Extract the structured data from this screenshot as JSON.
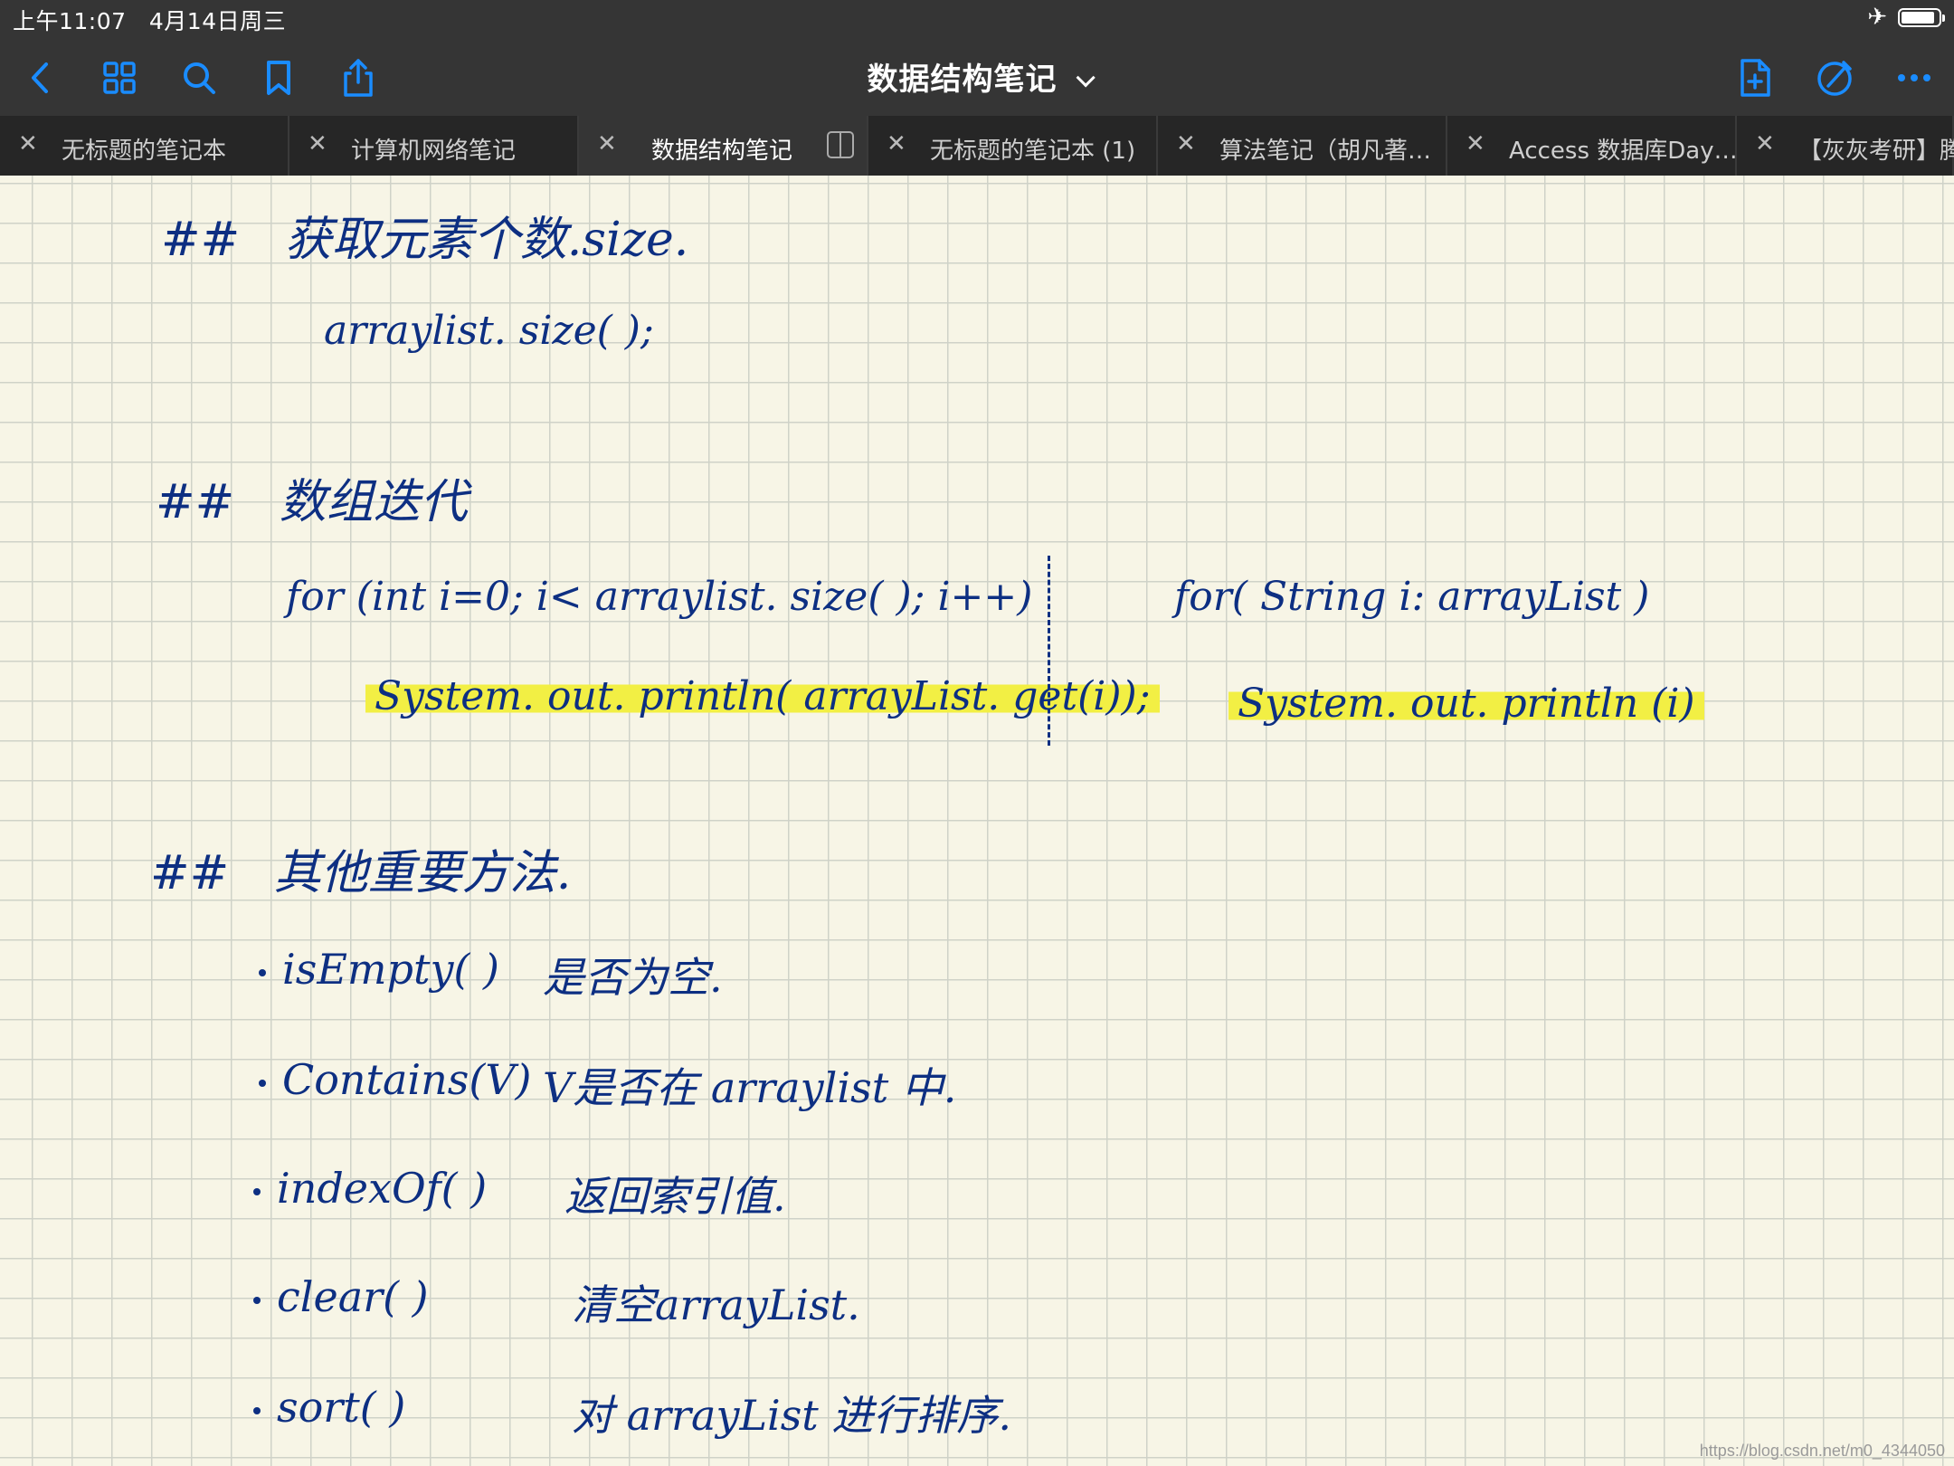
{
  "status": {
    "time": "上午11:07",
    "date": "4月14日周三"
  },
  "toolbar": {
    "title": "数据结构笔记"
  },
  "tabs": [
    {
      "label": "无标题的笔记本"
    },
    {
      "label": "计算机网络笔记"
    },
    {
      "label": "数据结构笔记"
    },
    {
      "label": "无标题的笔记本 (1)"
    },
    {
      "label": "算法笔记（胡凡著…"
    },
    {
      "label": "Access 数据库Day…"
    },
    {
      "label": "【灰灰考研】腾"
    }
  ],
  "note": {
    "section1": {
      "mark": "##",
      "title": "获取元素个数.size.",
      "code": "arraylist. size( );"
    },
    "section2": {
      "mark": "##",
      "title": "数组迭代",
      "left_loop": "for (int i=0;  i< arraylist. size( ); i++)",
      "left_body": "System. out. println( arrayList. get(i));",
      "right_loop": "for( String i:  arrayList )",
      "right_body": "System. out. println (i)"
    },
    "section3": {
      "mark": "##",
      "title": "其他重要方法.",
      "items": [
        {
          "method": "isEmpty( )",
          "desc": "是否为空."
        },
        {
          "method": "Contains(V)",
          "desc": "V是否在 arraylist 中."
        },
        {
          "method": "indexOf( )",
          "desc": "返回索引值."
        },
        {
          "method": "clear( )",
          "desc": "清空arrayList."
        },
        {
          "method": "sort( )",
          "desc": "对 arrayList 进行排序."
        }
      ]
    }
  },
  "watermark": "https://blog.csdn.net/m0_4344050",
  "colors": {
    "ink": "#0d2f82",
    "highlight": "#f2ef44",
    "toolbar": "#353535",
    "accent": "#1a8cff"
  }
}
